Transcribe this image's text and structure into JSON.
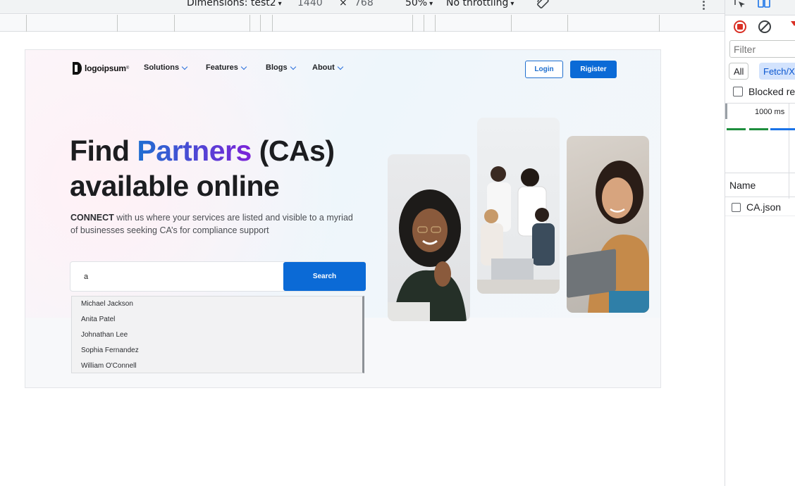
{
  "device_toolbar": {
    "dimensions_label": "Dimensions: test2",
    "width": "1440",
    "times": "×",
    "height": "768",
    "zoom": "50%",
    "throttling": "No throttling",
    "caret": "▾"
  },
  "site": {
    "logo_text": "logoipsum",
    "logo_tm": "®",
    "nav": [
      {
        "label": "Solutions"
      },
      {
        "label": "Features"
      },
      {
        "label": "Blogs"
      },
      {
        "label": "About"
      }
    ],
    "login_label": "Login",
    "register_label": "Rigister",
    "hero": {
      "find": "Find ",
      "partners": "Partners",
      "cas": " (CAs)",
      "line2": "available online",
      "sub_bold": "CONNECT",
      "sub_rest": " with us where your services are listed and visible to a myriad of businesses seeking CA’s for compliance support"
    },
    "search": {
      "value": "a",
      "button_label": "Search",
      "suggestions": [
        "Michael Jackson",
        "Anita Patel",
        "Johnathan Lee",
        "Sophia Fernandez",
        "William O'Connell"
      ]
    }
  },
  "devtools": {
    "filter_placeholder": "Filter",
    "chips": {
      "all": "All",
      "fetch": "Fetch/XHR"
    },
    "blocked_label": "Blocked response cookies",
    "overview_label": "1000 ms",
    "name_header": "Name",
    "requests": [
      {
        "name": "CA.json"
      }
    ]
  },
  "colors": {
    "brand_blue": "#0b6ad6",
    "accent_purple": "#7c22d8",
    "record_red": "#d93025",
    "chip_blue": "#d3e3fd"
  }
}
